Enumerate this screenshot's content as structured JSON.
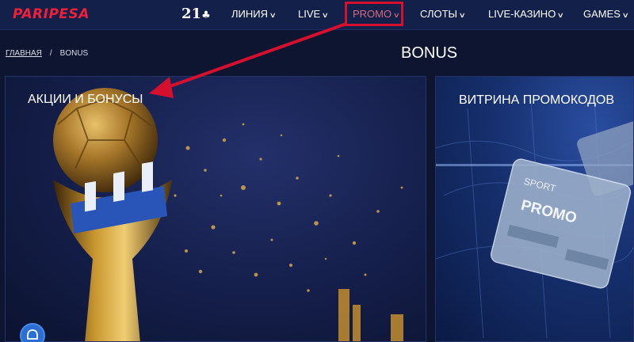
{
  "header": {
    "logo": "PARIPESA",
    "twentyone_label": "21",
    "nav": [
      {
        "label": "ЛИНИЯ"
      },
      {
        "label": "LIVE"
      },
      {
        "label": "PROMO"
      },
      {
        "label": "СЛОТЫ"
      },
      {
        "label": "LIVE-КАЗИНО"
      },
      {
        "label": "GAMES"
      }
    ]
  },
  "breadcrumb": {
    "home": "ГЛАВНАЯ",
    "separator": "/",
    "current": "BONUS"
  },
  "page_title": "BONUS",
  "cards": [
    {
      "title": "АКЦИИ И БОНУСЫ"
    },
    {
      "title": "ВИТРИНА ПРОМОКОДОВ",
      "card_sport_label": "SPORT",
      "card_promo_label": "PROMO"
    }
  ],
  "colors": {
    "brand": "#f0203a",
    "header_bg": "#13204a",
    "page_bg": "#0d1531",
    "highlight": "#d5102e"
  }
}
